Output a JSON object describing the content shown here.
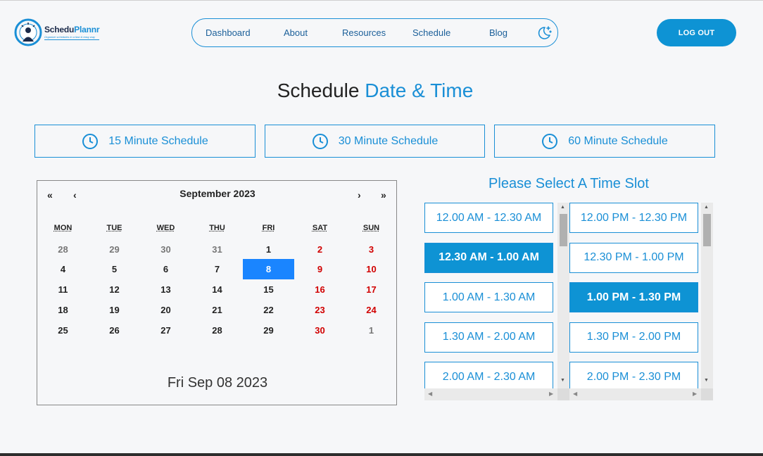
{
  "brand": {
    "name_a": "Schedu",
    "name_b": "Plannr",
    "tagline": "Organize schedules in a fast & easy way"
  },
  "nav": {
    "items": [
      "Dashboard",
      "About",
      "Resources",
      "Schedule",
      "Blog"
    ],
    "theme_icon": "moon-stars-icon"
  },
  "logout_label": "LOG OUT",
  "page_title": {
    "part1": "Schedule",
    "part2": "Date & Time"
  },
  "schedule_options": [
    "15 Minute Schedule",
    "30 Minute Schedule",
    "60 Minute Schedule"
  ],
  "calendar": {
    "first": "«",
    "prev": "‹",
    "next": "›",
    "last": "»",
    "month": "September 2023",
    "weekdays": [
      "MON",
      "TUE",
      "WED",
      "THU",
      "FRI",
      "SAT",
      "SUN"
    ],
    "weeks": [
      [
        "28",
        "29",
        "30",
        "31",
        "1",
        "2",
        "3"
      ],
      [
        "4",
        "5",
        "6",
        "7",
        "8",
        "9",
        "10"
      ],
      [
        "11",
        "12",
        "13",
        "14",
        "15",
        "16",
        "17"
      ],
      [
        "18",
        "19",
        "20",
        "21",
        "22",
        "23",
        "24"
      ],
      [
        "25",
        "26",
        "27",
        "28",
        "29",
        "30",
        "1"
      ]
    ],
    "selected_date": "Fri Sep 08 2023"
  },
  "slots": {
    "title": "Please Select A Time Slot",
    "am": [
      "12.00 AM - 12.30 AM",
      "12.30 AM - 1.00 AM",
      "1.00 AM - 1.30 AM",
      "1.30 AM - 2.00 AM",
      "2.00 AM - 2.30 AM"
    ],
    "pm": [
      "12.00 PM - 12.30 PM",
      "12.30 PM - 1.00 PM",
      "1.00 PM - 1.30 PM",
      "1.30 PM - 2.00 PM",
      "2.00 PM - 2.30 PM"
    ],
    "am_active": "12.30 AM - 1.00 AM",
    "pm_active": "1.00 PM - 1.30 PM"
  },
  "colors": {
    "accent": "#1a8fd6",
    "selected_day": "#1a85ff",
    "weekend": "#d10000"
  }
}
